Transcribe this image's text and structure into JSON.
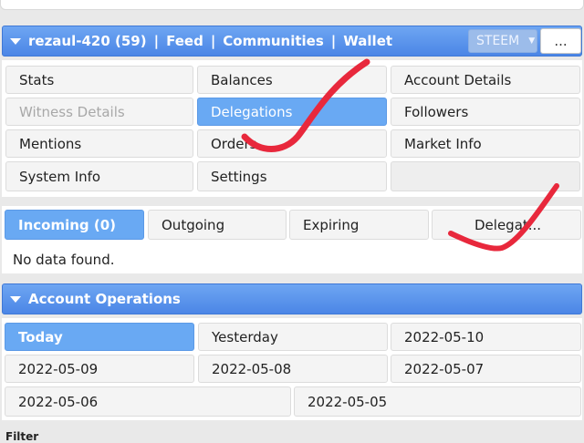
{
  "header": {
    "user_label": "rezaul-420 (59)",
    "links": [
      "Feed",
      "Communities",
      "Wallet"
    ],
    "separator": "|",
    "currency_selected": "STEEM",
    "more_label": "..."
  },
  "menu": {
    "items": [
      {
        "label": "Stats"
      },
      {
        "label": "Balances"
      },
      {
        "label": "Account Details"
      },
      {
        "label": "Witness Details"
      },
      {
        "label": "Delegations"
      },
      {
        "label": "Followers"
      },
      {
        "label": "Mentions"
      },
      {
        "label": "Orders"
      },
      {
        "label": "Market Info"
      },
      {
        "label": "System Info"
      },
      {
        "label": "Settings"
      }
    ],
    "active": "Delegations",
    "disabled": "Witness Details"
  },
  "delegations": {
    "tabs": [
      "Incoming (0)",
      "Outgoing",
      "Expiring",
      "Delegat..."
    ],
    "active_tab": "Incoming (0)",
    "empty_text": "No data found."
  },
  "operations": {
    "title": "Account Operations",
    "days": [
      "Today",
      "Yesterday",
      "2022-05-10",
      "2022-05-09",
      "2022-05-08",
      "2022-05-07",
      "2022-05-06",
      "2022-05-05"
    ],
    "active_day": "Today"
  },
  "filter_label": "Filter",
  "colors": {
    "accent": "#69a9f3",
    "header": "#4b86e6",
    "annotation": "#e8283c"
  }
}
